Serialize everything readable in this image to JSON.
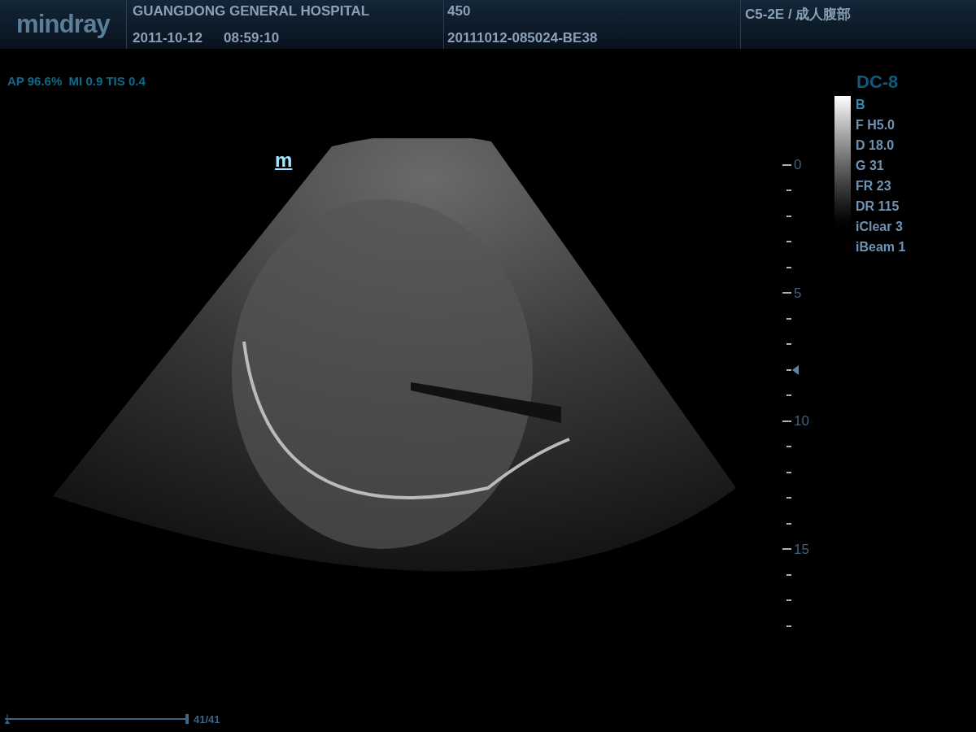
{
  "header": {
    "logo": "mindray",
    "hospital": "GUANGDONG GENERAL HOSPITAL",
    "date": "2011-10-12",
    "time": "08:59:10",
    "patient_id": "450",
    "exam_id": "20111012-085024-BE38",
    "probe_preset": "C5-2E / 成人腹部"
  },
  "acoustic_output": "AP 96.6%  MI 0.9 TIS 0.4",
  "orientation_marker": "m",
  "depth_scale": {
    "labels": [
      "0",
      "5",
      "10",
      "15"
    ]
  },
  "parameters": {
    "title": "DC-8",
    "mode": "B",
    "items": [
      "F H5.0",
      "D 18.0",
      "G 31",
      "FR 23",
      "DR 115",
      "iClear 3",
      "iBeam 1"
    ]
  },
  "cine": {
    "level": 1,
    "counter": "41/41"
  }
}
